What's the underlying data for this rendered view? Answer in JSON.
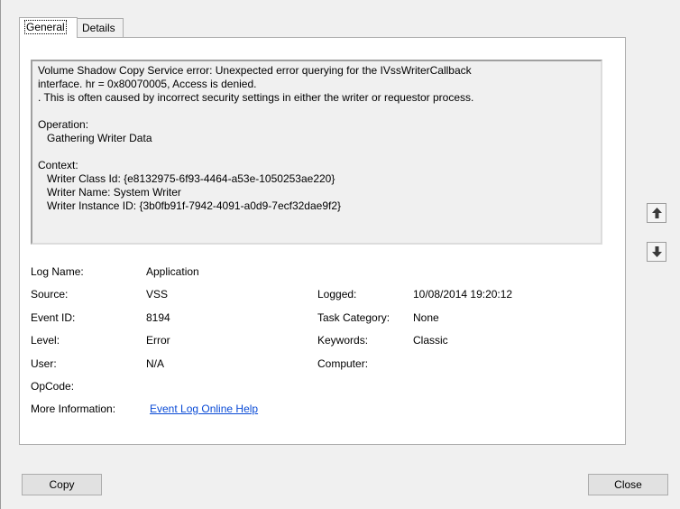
{
  "tabs": [
    "General",
    "Details"
  ],
  "description": {
    "lines": [
      "Volume Shadow Copy Service error: Unexpected error querying for the IVssWriterCallback",
      "interface.  hr = 0x80070005, Access is denied.",
      ". This is often caused by incorrect security settings in either the writer or requestor process."
    ],
    "operation_label": "Operation:",
    "operation_value": "Gathering Writer Data",
    "context_label": "Context:",
    "context_lines": [
      "Writer Class Id: {e8132975-6f93-4464-a53e-1050253ae220}",
      "Writer Name: System Writer",
      "Writer Instance ID: {3b0fb91f-7942-4091-a0d9-7ecf32dae9f2}"
    ]
  },
  "fields": {
    "log_name_label": "Log Name:",
    "log_name_value": "Application",
    "source_label": "Source:",
    "source_value": "VSS",
    "logged_label": "Logged:",
    "logged_value": "10/08/2014 19:20:12",
    "event_id_label": "Event ID:",
    "event_id_value": "8194",
    "task_category_label": "Task Category:",
    "task_category_value": "None",
    "level_label": "Level:",
    "level_value": "Error",
    "keywords_label": "Keywords:",
    "keywords_value": "Classic",
    "user_label": "User:",
    "user_value": "N/A",
    "computer_label": "Computer:",
    "computer_value": "",
    "opcode_label": "OpCode:",
    "opcode_value": "",
    "more_info_label": "More Information:",
    "more_info_link": "Event Log Online Help"
  },
  "buttons": {
    "copy": "Copy",
    "close": "Close",
    "previous_icon": "arrow-up-icon",
    "next_icon": "arrow-down-icon"
  }
}
